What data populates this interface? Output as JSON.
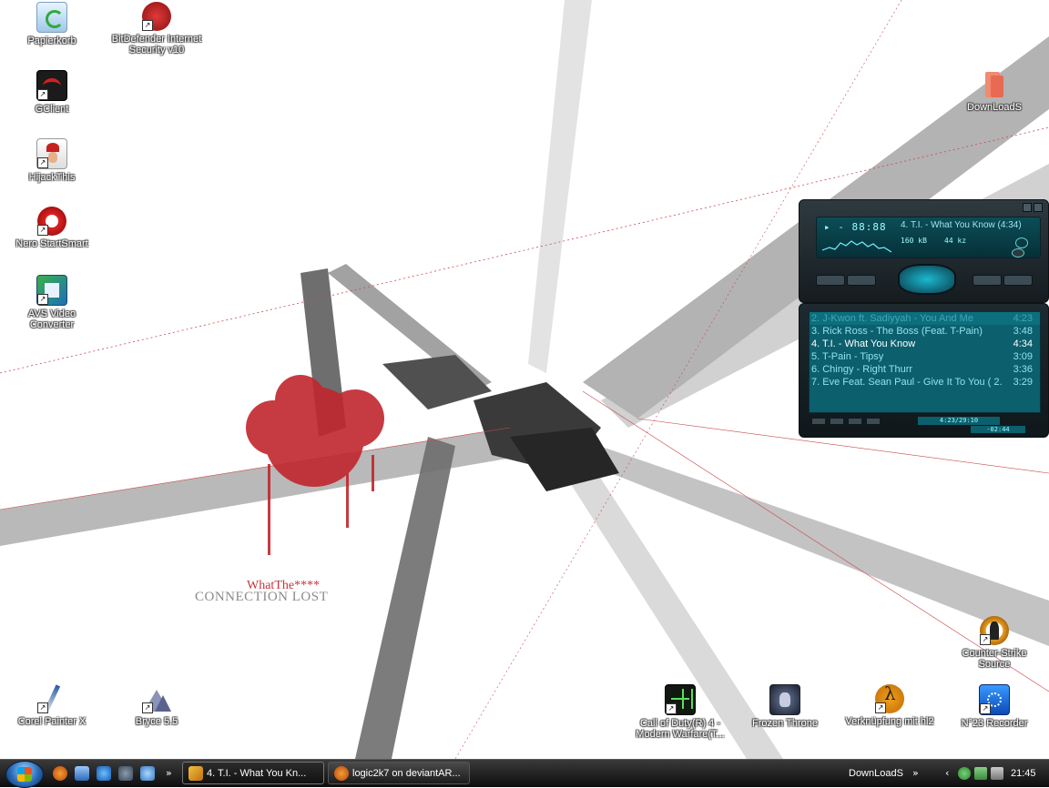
{
  "desktop": {
    "icons": [
      {
        "label": "Papierkorb"
      },
      {
        "label": "BitDefender Internet Security v10"
      },
      {
        "label": "GClient"
      },
      {
        "label": "HijackThis"
      },
      {
        "label": "Nero StartSmart"
      },
      {
        "label": "AVS Video Converter"
      },
      {
        "label": "DownLoadS"
      },
      {
        "label": "Counter-Strike Source"
      },
      {
        "label": "Corel Painter X"
      },
      {
        "label": "Bryce 5.5"
      },
      {
        "label": "Call of Duty(R) 4 - Modern Warfare(T..."
      },
      {
        "label": "Frozen Throne"
      },
      {
        "label": "Verknüpfung mit hl2"
      },
      {
        "label": "N°23 Recorder"
      }
    ],
    "wallpaper_text": {
      "line1": "WhatThe****",
      "line2": "CONNECTION LOST"
    }
  },
  "winamp": {
    "time": "▸ - 88:88",
    "song_title": "4. T.I. - What You Know (4:34)",
    "kbps": "160 kB",
    "khz": "44 kz",
    "playlist": [
      {
        "title": "2. J-Kwon ft. Sadiyyah - You And Me",
        "duration": "4:23",
        "state": "dim"
      },
      {
        "title": "3. Rick Ross - The Boss (Feat. T-Pain)",
        "duration": "3:48",
        "state": "normal"
      },
      {
        "title": "4. T.I. - What You Know",
        "duration": "4:34",
        "state": "current"
      },
      {
        "title": "5. T-Pain - Tipsy",
        "duration": "3:09",
        "state": "normal"
      },
      {
        "title": "6. Chingy - Right Thurr",
        "duration": "3:36",
        "state": "normal"
      },
      {
        "title": "7. Eve Feat. Sean Paul - Give It To You ( 2...",
        "duration": "3:29",
        "state": "normal"
      }
    ],
    "total_time": "4:23/29:10",
    "remaining": "-02:44"
  },
  "taskbar": {
    "buttons": [
      {
        "label": "4. T.I. - What You Kn..."
      },
      {
        "label": "logic2k7 on deviantAR..."
      }
    ],
    "chevron": "»",
    "toolbar_label": "DownLoadS",
    "tray_arrow": "‹",
    "clock": "21:45"
  },
  "colors": {
    "accent_red": "#c4343a",
    "lcd": "#0c5f6d",
    "taskbar": "#1a1a1a"
  }
}
